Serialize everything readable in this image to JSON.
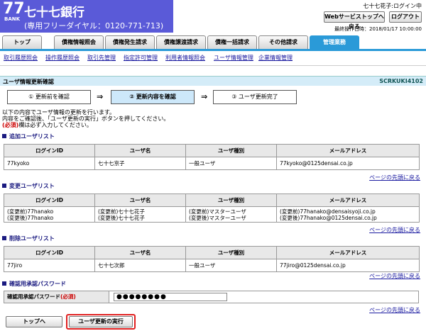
{
  "header": {
    "logo_number": "77",
    "logo_bank": "BANK",
    "bank_name": "七十七銀行",
    "dial": "(専用フリーダイヤル：0120-771-713)",
    "user_status": "七十七花子:ログイン中",
    "web_service_top": "Webサービストップへ戻る",
    "logout": "ログアウト",
    "last_login": "最終操作日時：2018/01/17 10:00:00",
    "brand_color": "#5a5ad8"
  },
  "tabs": [
    {
      "label": "トップ"
    },
    {
      "label": "債権情報照会"
    },
    {
      "label": "債権発生請求"
    },
    {
      "label": "債権譲渡請求"
    },
    {
      "label": "債権一括請求"
    },
    {
      "label": "その他請求"
    },
    {
      "label": "管理業務"
    }
  ],
  "subnav": [
    {
      "label": "取引履歴照会"
    },
    {
      "label": "操作履歴照会"
    },
    {
      "label": "取引先管理"
    },
    {
      "label": "指定許可管理"
    },
    {
      "label": "利用者情報照会"
    },
    {
      "label": "ユーザ情報管理"
    },
    {
      "label": "企業情報管理"
    }
  ],
  "page": {
    "title": "ユーザ情報更新確認",
    "code": "SCRKUKI4102",
    "steps": [
      {
        "label": "① 更新前を確認"
      },
      {
        "label": "② 更新内容を確認"
      },
      {
        "label": "③ ユーザ更新完了"
      }
    ],
    "arrow": "⇒",
    "info_line1": "以下の内容でユーザ情報の更新を行います。",
    "info_line2": "内容をご確認後、「ユーザ更新の実行」ボタンを押してください。",
    "info_req": "(必須)",
    "info_line3": "欄は必ず入力してください。"
  },
  "columns": {
    "login_id": "ログインID",
    "user_name": "ユーザ名",
    "user_type": "ユーザ種別",
    "email": "メールアドレス"
  },
  "sections": {
    "add": {
      "title": "追加ユーザリスト",
      "rows": [
        {
          "login_id": "77kyoko",
          "user_name": "七十七京子",
          "user_type": "一般ユーザ",
          "email": "77kyoko@0125densai.co.jp"
        }
      ]
    },
    "change": {
      "title": "変更ユーザリスト",
      "rows": [
        {
          "login_id_before": "(変更前)77hanako",
          "login_id_after": "(変更後)77hanako",
          "user_name_before": "(変更前)七十七花子",
          "user_name_after": "(変更後)七十七花子",
          "user_type_before": "(変更前)マスターユーザ",
          "user_type_after": "(変更後)マスターユーザ",
          "email_before": "(変更前)77hanako@densaisyoji.co.jp",
          "email_after": "(変更後)77hanako@0125densai.co.jp"
        }
      ]
    },
    "delete": {
      "title": "削除ユーザリスト",
      "rows": [
        {
          "login_id": "77jiro",
          "user_name": "七十七次郎",
          "user_type": "一般ユーザ",
          "email": "77jiro@0125densai.co.jp"
        }
      ]
    },
    "password": {
      "title": "確認用承認パスワード",
      "label": "確認用承認パスワード",
      "req": "(必須)",
      "value": "●●●●●●●●"
    }
  },
  "page_top_link": "ページの先頭に戻る",
  "buttons": {
    "top": "トップへ",
    "execute": "ユーザ更新の実行"
  }
}
